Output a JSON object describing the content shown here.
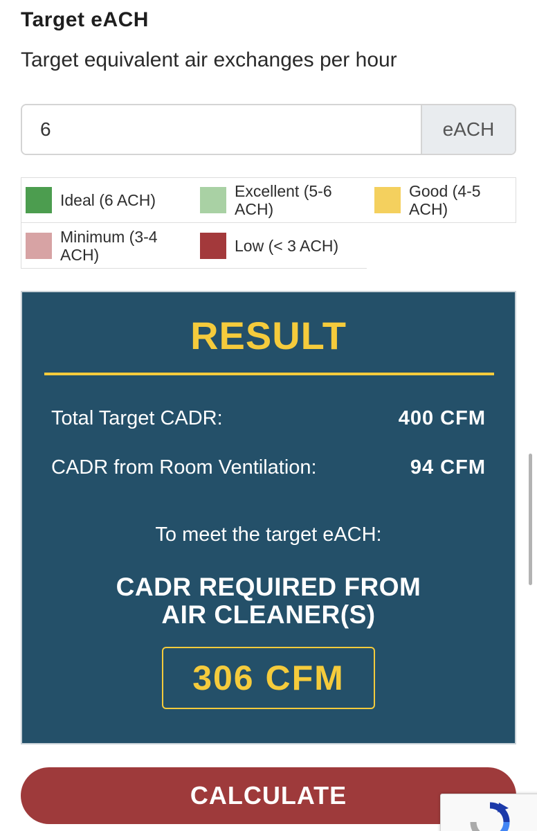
{
  "section": {
    "title": "Target eACH",
    "subtitle": "Target equivalent air exchanges per hour"
  },
  "input": {
    "value": "6",
    "addon": "eACH"
  },
  "legend": [
    {
      "label": "Ideal (6 ACH)",
      "color": "#4c9d4f"
    },
    {
      "label": "Excellent (5-6 ACH)",
      "color": "#a9d1a4"
    },
    {
      "label": "Good (4-5 ACH)",
      "color": "#f4d05e"
    },
    {
      "label": "Minimum (3-4 ACH)",
      "color": "#d7a3a4"
    },
    {
      "label": "Low (< 3 ACH)",
      "color": "#a3393b"
    }
  ],
  "result": {
    "title": "RESULT",
    "total_label": "Total Target CADR:",
    "total_value": "400 CFM",
    "ventilation_label": "CADR from Room Ventilation:",
    "ventilation_value": "94 CFM",
    "meet_text": "To meet the target eACH:",
    "required_heading_line1": "CADR REQUIRED FROM",
    "required_heading_line2": "AIR CLEANER(S)",
    "required_value": "306 CFM"
  },
  "button": {
    "calculate_label": "CALCULATE"
  },
  "colors": {
    "result_bg": "#245069",
    "accent_yellow": "#f5cb3c",
    "button_red": "#9e3a3b"
  },
  "icons": {
    "recaptcha": "recaptcha-icon"
  }
}
